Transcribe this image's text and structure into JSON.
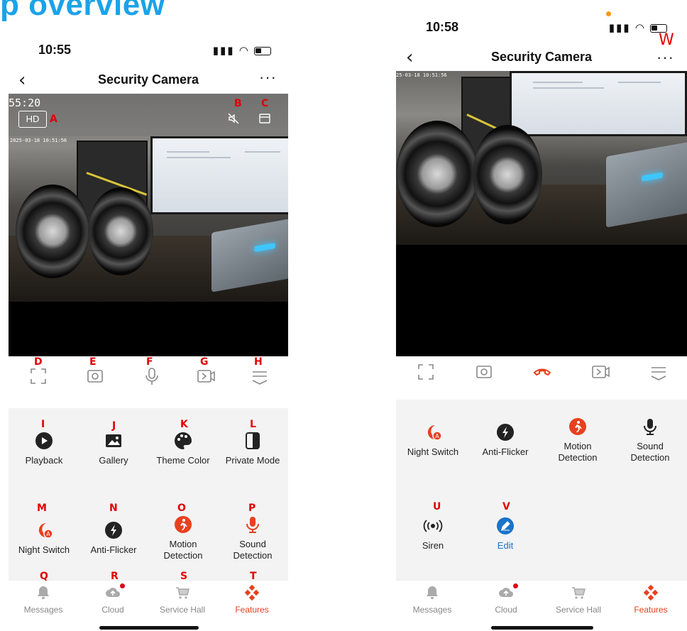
{
  "page": {
    "heading_text": "p overview"
  },
  "left_phone": {
    "status": {
      "time": "10:55"
    },
    "nav": {
      "title": "Security Camera",
      "back_glyph": "‹",
      "more_glyph": "···"
    },
    "video": {
      "clock_overlay": "55:20",
      "timestamp": "2025-03-18 10:51:56",
      "hd_badge": "HD",
      "overlay_icons": [
        "mute-icon",
        "screen-icon"
      ]
    },
    "controls": [
      "fullscreen-icon",
      "screenshot-icon",
      "microphone-icon",
      "record-icon",
      "collapse-icon"
    ],
    "features": [
      {
        "label": "Playback",
        "icon": "playback-icon",
        "color": "#222222"
      },
      {
        "label": "Gallery",
        "icon": "gallery-icon",
        "color": "#222222"
      },
      {
        "label": "Theme Color",
        "icon": "palette-icon",
        "color": "#222222"
      },
      {
        "label": "Private Mode",
        "icon": "private-mode-icon",
        "color": "#222222"
      },
      {
        "label": "Night Switch",
        "icon": "night-switch-icon",
        "color": "#e8401f"
      },
      {
        "label": "Anti-Flicker",
        "icon": "anti-flicker-icon",
        "color": "#222222"
      },
      {
        "label_line1": "Motion",
        "label_line2": "Detection",
        "icon": "motion-detection-icon",
        "color": "#e8401f"
      },
      {
        "label_line1": "Sound",
        "label_line2": "Detection",
        "icon": "sound-detection-icon",
        "color": "#e8401f"
      }
    ],
    "tabs": [
      {
        "label": "Messages",
        "icon": "bell-icon"
      },
      {
        "label": "Cloud",
        "icon": "cloud-upload-icon"
      },
      {
        "label": "Service Hall",
        "icon": "cart-icon"
      },
      {
        "label": "Features",
        "icon": "features-icon"
      }
    ]
  },
  "right_phone": {
    "status": {
      "time": "10:58"
    },
    "nav": {
      "title": "Security Camera",
      "back_glyph": "‹",
      "more_glyph": "···"
    },
    "video": {
      "timestamp": "25-03-18 10:51:56"
    },
    "controls": [
      "fullscreen-icon",
      "screenshot-icon",
      "hang-up-icon",
      "record-icon",
      "collapse-icon"
    ],
    "features": [
      {
        "label": "Night Switch",
        "icon": "night-switch-icon"
      },
      {
        "label": "Anti-Flicker",
        "icon": "anti-flicker-icon"
      },
      {
        "label_line1": "Motion",
        "label_line2": "Detection",
        "icon": "motion-detection-icon"
      },
      {
        "label_line1": "Sound",
        "label_line2": "Detection",
        "icon": "sound-detection-icon"
      },
      {
        "label": "Siren",
        "icon": "siren-icon"
      },
      {
        "label": "Edit",
        "icon": "edit-icon"
      }
    ],
    "tabs": [
      {
        "label": "Messages",
        "icon": "bell-icon"
      },
      {
        "label": "Cloud",
        "icon": "cloud-upload-icon"
      },
      {
        "label": "Service Hall",
        "icon": "cart-icon"
      },
      {
        "label": "Features",
        "icon": "features-icon"
      }
    ]
  },
  "annotations": {
    "A": "A",
    "B": "B",
    "C": "C",
    "D": "D",
    "E": "E",
    "F": "F",
    "G": "G",
    "H": "H",
    "I": "I",
    "J": "J",
    "K": "K",
    "L": "L",
    "M": "M",
    "N": "N",
    "O": "O",
    "P": "P",
    "Q": "Q",
    "R": "R",
    "S": "S",
    "T": "T",
    "U": "U",
    "V": "V",
    "W": "W"
  },
  "colors": {
    "accent_red": "#e8401f",
    "annotation_red": "#e00000",
    "heading_blue": "#1aa3e8",
    "edit_blue": "#1a73c9",
    "panel_gray": "#f3f3f3"
  }
}
